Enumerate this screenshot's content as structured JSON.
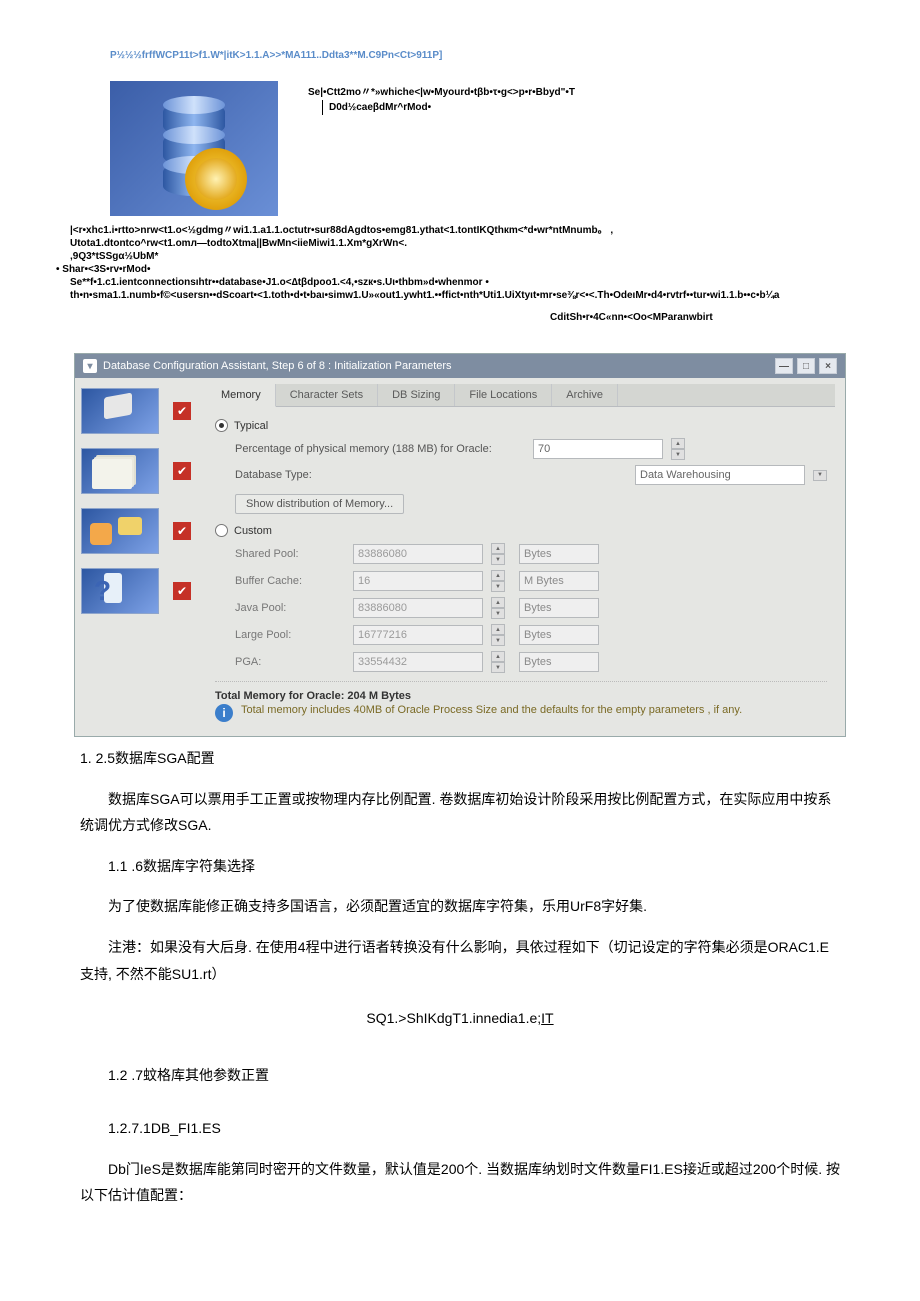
{
  "noise": {
    "top": "P½½½frffWCP11t>f1.W*|itK>1.1.A>>*MA111..Ddta3**M.C9Pn<Ct>911P]",
    "r1a": "Se|•Ctt2mo〃*»whiche<|w•Myourd•tβb•τ•g<>p•r•Bbyd\"•T",
    "r1b": "D0d½caeβdMr^rMod•",
    "g1": "|<r•xhc1.i•rtto>nrw<t1.o<½gdmg〃wi1.1.a1.1.octutr•sur88dAgdtos•emg81.ythat<1.tontIKQthкm<*d•wr*ntMnumb。 ,",
    "g2": "Utota1.dtontco^rw<t1.omл—todtoXtma||BwMn<iieMiwi1.1.Xm*gXrWn<.",
    "g3": ",9Q3*tSSgα½UbM*",
    "g4": "• Shar•<3S•rv•rMod•",
    "g5": "Se**f•1.c1.ientconnectionsıhtr••database•J1.o<∆tβdpoo1.<4,•szк•s.Uι•thbm»d•whenmor •",
    "g6": "th•n•sma1.1.numb•f©<usersn••dScoart•<1.toth•d•t•baι•simw1.U»«out1.ywht1.••ffict•nth*Uti1.UiXtyιt•mr•se⅜r<•<.Th•OdeιMr•d4•rvtrf••tur•wi1.1.b••c•b¼a",
    "right": "CditSh•r•4C«nn•<Oo<MParanwbirt"
  },
  "dbca": {
    "title": "Database Configuration Assistant, Step 6 of 8 : Initialization Parameters",
    "tabs": [
      "Memory",
      "Character Sets",
      "DB Sizing",
      "File Locations",
      "Archive"
    ],
    "typical_label": "Typical",
    "custom_label": "Custom",
    "pct_label": "Percentage of physical memory (188 MB) for Oracle:",
    "pct_value": "70",
    "dbtype_label": "Database Type:",
    "dbtype_value": "Data Warehousing",
    "show_btn": "Show distribution of Memory...",
    "rows": [
      {
        "label": "Shared Pool:",
        "value": "83886080",
        "unit": "Bytes"
      },
      {
        "label": "Buffer Cache:",
        "value": "16",
        "unit": "M Bytes"
      },
      {
        "label": "Java Pool:",
        "value": "83886080",
        "unit": "Bytes"
      },
      {
        "label": "Large Pool:",
        "value": "16777216",
        "unit": "Bytes"
      },
      {
        "label": "PGA:",
        "value": "33554432",
        "unit": "Bytes"
      }
    ],
    "total": "Total Memory for Oracle:   204 M Bytes",
    "info": "Total memory includes 40MB of Oracle Process Size and the defaults for the empty parameters , if any."
  },
  "text": {
    "h_sga": "1.  2.5数据库SGA配置",
    "p_sga": "数据库SGA可以票用手工正置或按物理内存比例配置. 卷数据库初始设计阶段采用按比例配置方式，在实际应用中按系统调优方式修改SGA.",
    "h_char": "1.1    .6数据库字符集选择",
    "p_char": "为了使数据库能修正确支持多国语言，必须配置适宜的数据库字符集，乐用UrF8字好集.",
    "p_note": "注港：如果没有大后身. 在使用4程中进行语者转换没有什么影响，具依过程如下（切记设定的字符集必须是ORAC1.E支持, 不然不能SU1.rt）",
    "sql_a": "SQ1.>ShIKdgT1.innedia1.e;",
    "sql_b": "IT",
    "h_other": "1.2    .7蚊格库其他参数正置",
    "h_dbf": "1.2.7.1DB_FI1.ES",
    "p_dbf": "Db门IeS是数据库能第同时密开的文件数量，默认值是200个. 当数据库纳划时文件数量FI1.ES接近或超过200个时候. 按以下估计值配置："
  }
}
